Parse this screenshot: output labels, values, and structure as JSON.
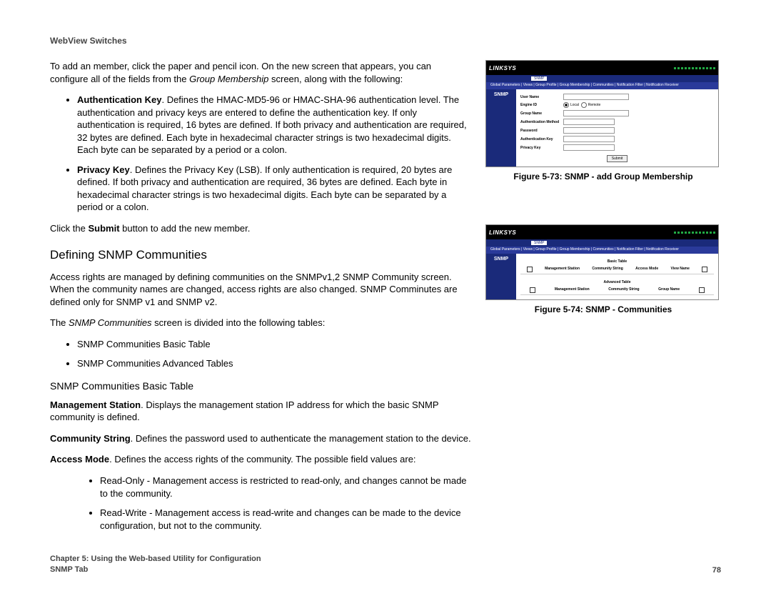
{
  "doc_header": "WebView Switches",
  "intro": {
    "lead": "To add an member, click the paper and pencil icon. On the new screen that appears, you can configure all of the fields from the ",
    "ital": "Group Membership",
    "tail": " screen, along with the following:"
  },
  "auth_key": {
    "label": "Authentication Key",
    "text": ". Defines the HMAC-MD5-96 or HMAC-SHA-96 authentication level. The authentication and privacy keys are entered to define the authentication key. If only authentication is required, 16 bytes are defined. If both privacy and authentication are required, 32 bytes are defined. Each byte in hexadecimal character strings is two hexadecimal digits. Each byte can be separated by a period or a colon."
  },
  "privacy_key": {
    "label": "Privacy Key",
    "text": ". Defines the Privacy Key (LSB). If only authentication is required, 20 bytes are defined. If both privacy and authentication are required, 36 bytes are defined. Each byte in hexadecimal character strings is two hexadecimal digits. Each byte can be separated by a period or a colon."
  },
  "submit_line": {
    "lead": "Click the ",
    "bold": "Submit",
    "tail": " button to add the new member."
  },
  "section_heading": "Defining SNMP Communities",
  "communities_para": "Access rights are managed by defining communities on the SNMPv1,2 SNMP Community screen. When the community names are changed, access rights are also changed. SNMP Comminutes are defined only for SNMP v1 and SNMP v2.",
  "communities_divided": {
    "lead": "The ",
    "ital": "SNMP Communities",
    "tail": " screen is divided into the following tables:"
  },
  "table_items": [
    "SNMP Communities Basic Table",
    "SNMP Communities Advanced Tables"
  ],
  "subsection_heading": "SNMP Communities Basic Table",
  "mgmt_station": {
    "label": "Management Station",
    "text": ". Displays the management station IP address for which the basic SNMP community is defined."
  },
  "community_string": {
    "label": "Community String",
    "text": ". Defines the password used to authenticate the management station to the device."
  },
  "access_mode": {
    "label": "Access Mode",
    "text": ". Defines the access rights of the community. The possible field values are:"
  },
  "access_mode_items": [
    "Read-Only - Management access is restricted to read-only, and changes cannot be made to the community.",
    "Read-Write - Management access is read-write and changes can be made to the device configuration, but not to the community."
  ],
  "figure73": {
    "caption": "Figure 5-73: SNMP - add Group Membership",
    "brand": "LINKSYS",
    "sidebar": "SNMP",
    "tabs": [
      "",
      "",
      "",
      "",
      "",
      "",
      "",
      "SNMP",
      ""
    ],
    "subtabs": "Global Parameters | Views | Group Profile | Group Membership | Communities | Notification Filter | Notification Receiver",
    "fields": {
      "user_name": "User Name",
      "engine_id": "Engine ID",
      "engine_local": "Local",
      "engine_remote": "Remote",
      "group_name": "Group Name",
      "auth_method": "Authentication Method",
      "password": "Password",
      "auth_key": "Authentication Key",
      "privacy_key": "Privacy Key",
      "submit": "Submit"
    }
  },
  "figure74": {
    "caption": "Figure 5-74: SNMP - Communities",
    "brand": "LINKSYS",
    "sidebar": "SNMP",
    "basic_title": "Basic Table",
    "basic_headers": [
      "Management Station",
      "Community String",
      "Access Mode",
      "View Name"
    ],
    "adv_title": "Advanced Table",
    "adv_headers": [
      "Management Station",
      "Community String",
      "Group Name"
    ]
  },
  "footer": {
    "chapter": "Chapter 5: Using the Web-based Utility for Configuration",
    "tab": "SNMP Tab",
    "page": "78"
  }
}
